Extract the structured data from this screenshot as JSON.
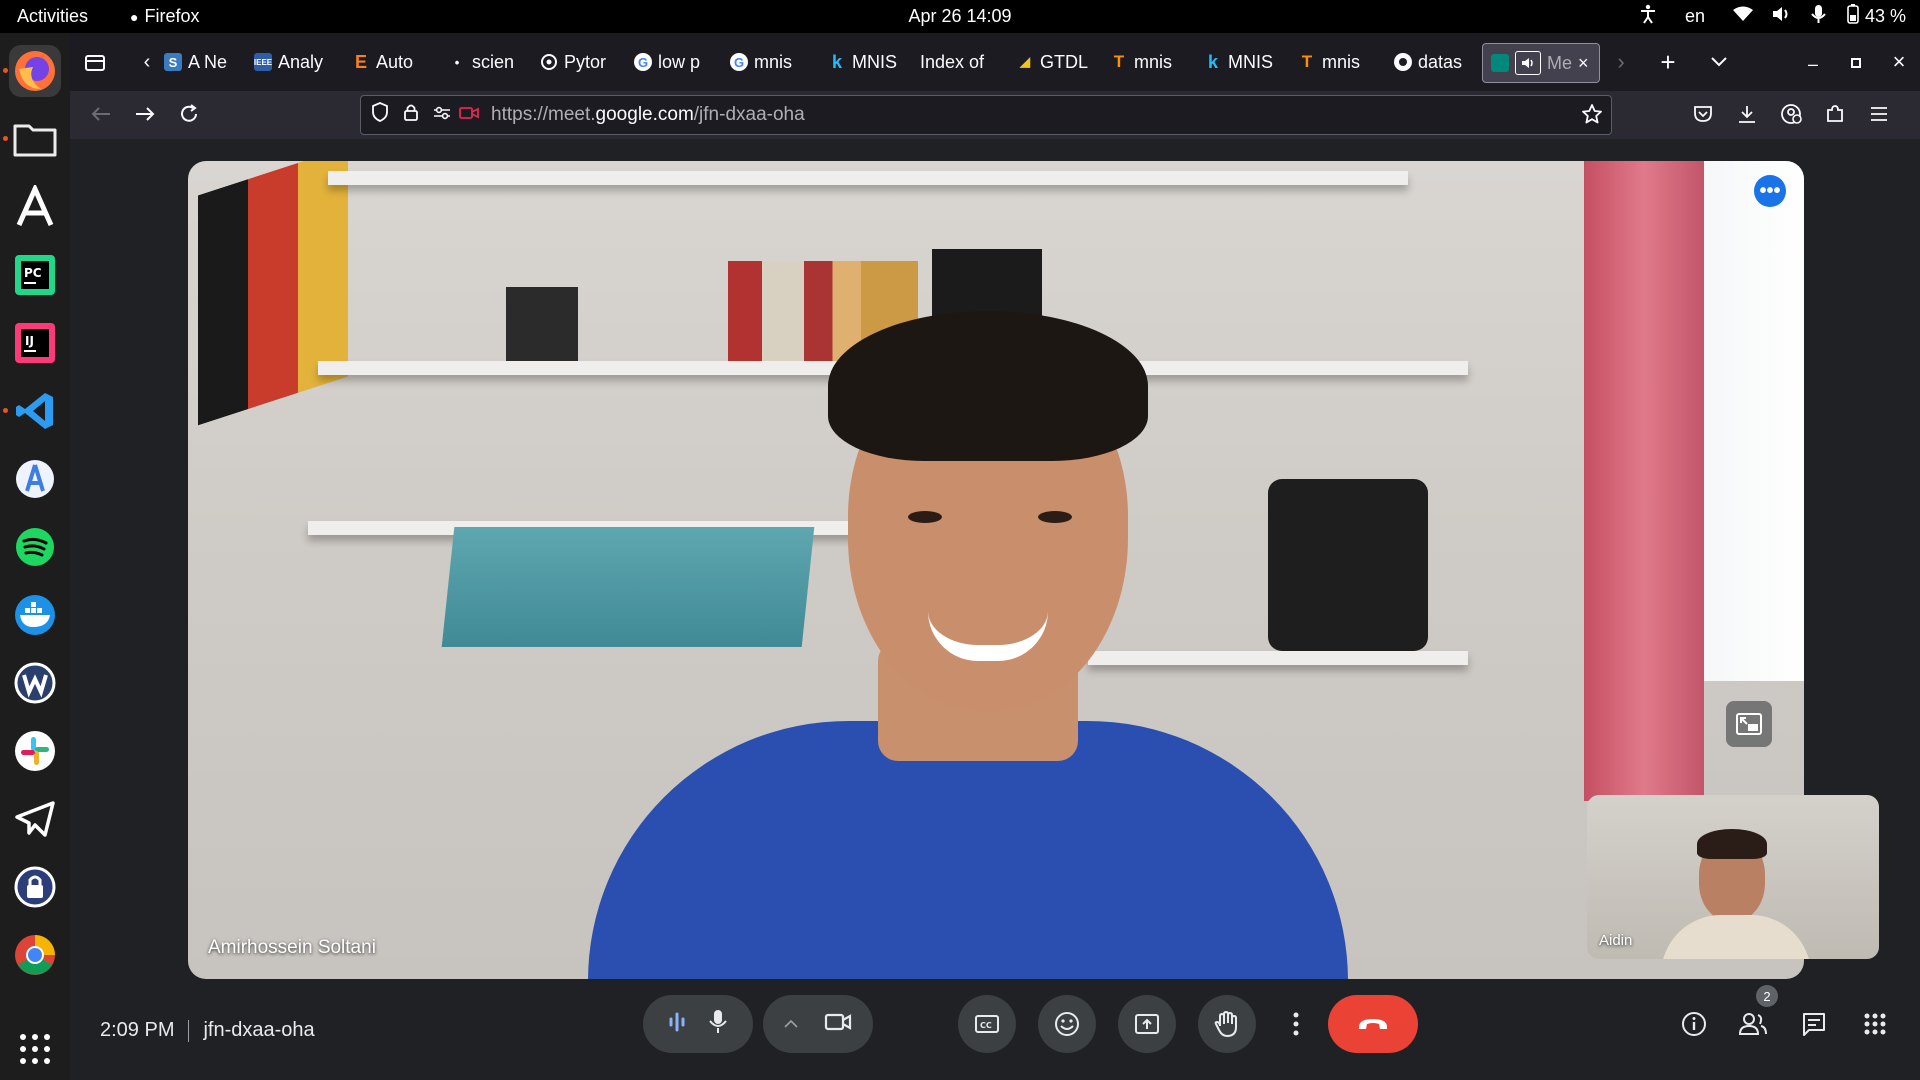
{
  "system": {
    "activities": "Activities",
    "app_name": "Firefox",
    "clock": "Apr 26  14:09",
    "language": "en",
    "battery": "43 %"
  },
  "tabs": [
    {
      "label": "A Ne",
      "favicon": "ieee-s-icon"
    },
    {
      "label": "Analy",
      "favicon": "ieee-icon"
    },
    {
      "label": "Auto",
      "favicon": "e-icon"
    },
    {
      "label": "scien",
      "favicon": "dot-icon"
    },
    {
      "label": "Pytor",
      "favicon": "openai-icon"
    },
    {
      "label": "low p",
      "favicon": "google-icon"
    },
    {
      "label": "mnis",
      "favicon": "google-icon"
    },
    {
      "label": "MNIS",
      "favicon": "kaggle-icon"
    },
    {
      "label": "Index of",
      "favicon": "none"
    },
    {
      "label": "GTDL",
      "favicon": "gtdl-icon"
    },
    {
      "label": "mnis",
      "favicon": "tensorflow-icon"
    },
    {
      "label": "MNIS",
      "favicon": "kaggle-icon"
    },
    {
      "label": "mnis",
      "favicon": "tensorflow-icon"
    },
    {
      "label": "datas",
      "favicon": "github-icon"
    },
    {
      "label": "Me",
      "favicon": "meet-icon",
      "active": true
    }
  ],
  "url": {
    "prefix": "https://meet.",
    "domain": "google.com",
    "path": "/jfn-dxaa-oha"
  },
  "meeting": {
    "main_participant": "Amirhossein Soltani",
    "self_participant": "Aidin",
    "time": "2:09 PM",
    "code": "jfn-dxaa-oha",
    "participant_count": "2"
  },
  "colors": {
    "hangup": "#ea4335",
    "accent": "#1a73e8",
    "control_bg": "#3c4043"
  }
}
